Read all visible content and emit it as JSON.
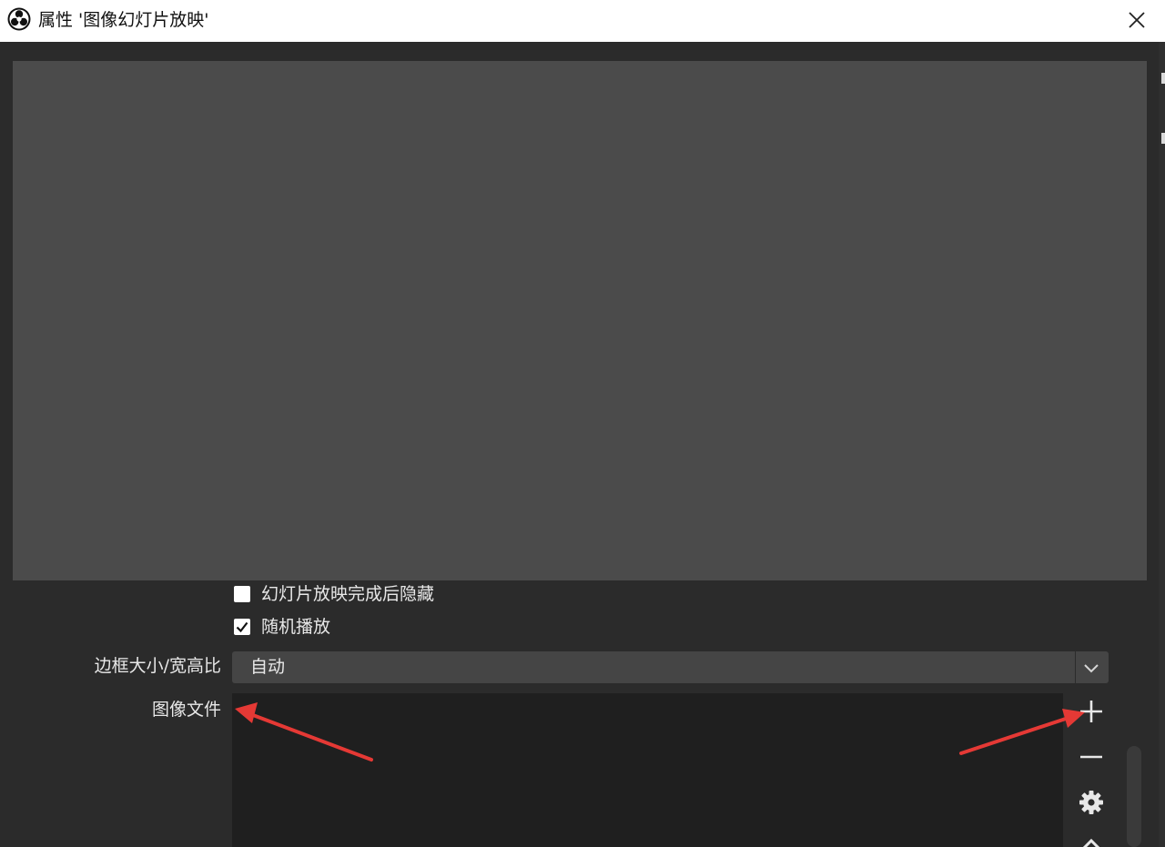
{
  "window": {
    "title": "属性 '图像幻灯片放映'",
    "icons": {
      "app": "obs-logo-icon",
      "close": "close-icon"
    }
  },
  "options": {
    "hide_when_done": {
      "label": "幻灯片放映完成后隐藏",
      "checked": false
    },
    "random_playback": {
      "label": "随机播放",
      "checked": true
    }
  },
  "bounding_size": {
    "label": "边框大小/宽高比",
    "value": "自动"
  },
  "image_files": {
    "label": "图像文件",
    "items": [],
    "tools": [
      "add-icon",
      "remove-icon",
      "gear-icon",
      "move-up-icon"
    ]
  },
  "annotation": {
    "arrow_color": "#e53935"
  },
  "colors": {
    "background": "#2b2b2b",
    "preview": "#4b4b4b",
    "list_background": "#1f1f1f",
    "text": "#e8e8e8"
  }
}
